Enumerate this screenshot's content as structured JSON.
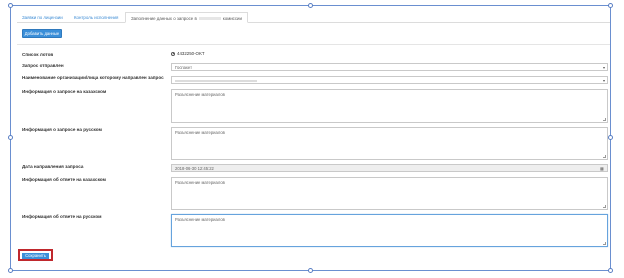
{
  "tabs": [
    {
      "label": "Заявки по лицензии"
    },
    {
      "label": "Контроль исполнения"
    },
    {
      "label_prefix": "Заполнение данных о запросе в",
      "label_suffix": "комиссии"
    }
  ],
  "toolbar": {
    "add_label": "Добавить данные"
  },
  "form": {
    "lot_list": {
      "label": "Список лотов",
      "option": "4432250-OKT"
    },
    "request_sent": {
      "label": "Запрос отправлен",
      "value": "Госпакет"
    },
    "org_name": {
      "label": "Наименование организации/лица которому направлен запрос"
    },
    "info_kz": {
      "label": "Информация о запросе на казахском",
      "placeholder": "Разъяснение материалов"
    },
    "info_ru": {
      "label": "Информация о запросе на русском",
      "placeholder": "Разъяснение материалов"
    },
    "date": {
      "label": "Дата направления запроса",
      "value": "2018-06-30 12:45:22"
    },
    "answer_kz": {
      "label": "Информация об ответе на казахском",
      "placeholder": "Разъяснение материалов"
    },
    "answer_ru": {
      "label": "Информация об ответе на русском",
      "placeholder": "Разъяснение материалов"
    }
  },
  "footer": {
    "save_label": "Сохранить"
  },
  "colors": {
    "accent": "#3b8fd9",
    "highlight": "#c0282d",
    "selection": "#6a8fd0"
  },
  "icons": {
    "date": "calendar-icon",
    "select": "chevron-down-icon"
  }
}
